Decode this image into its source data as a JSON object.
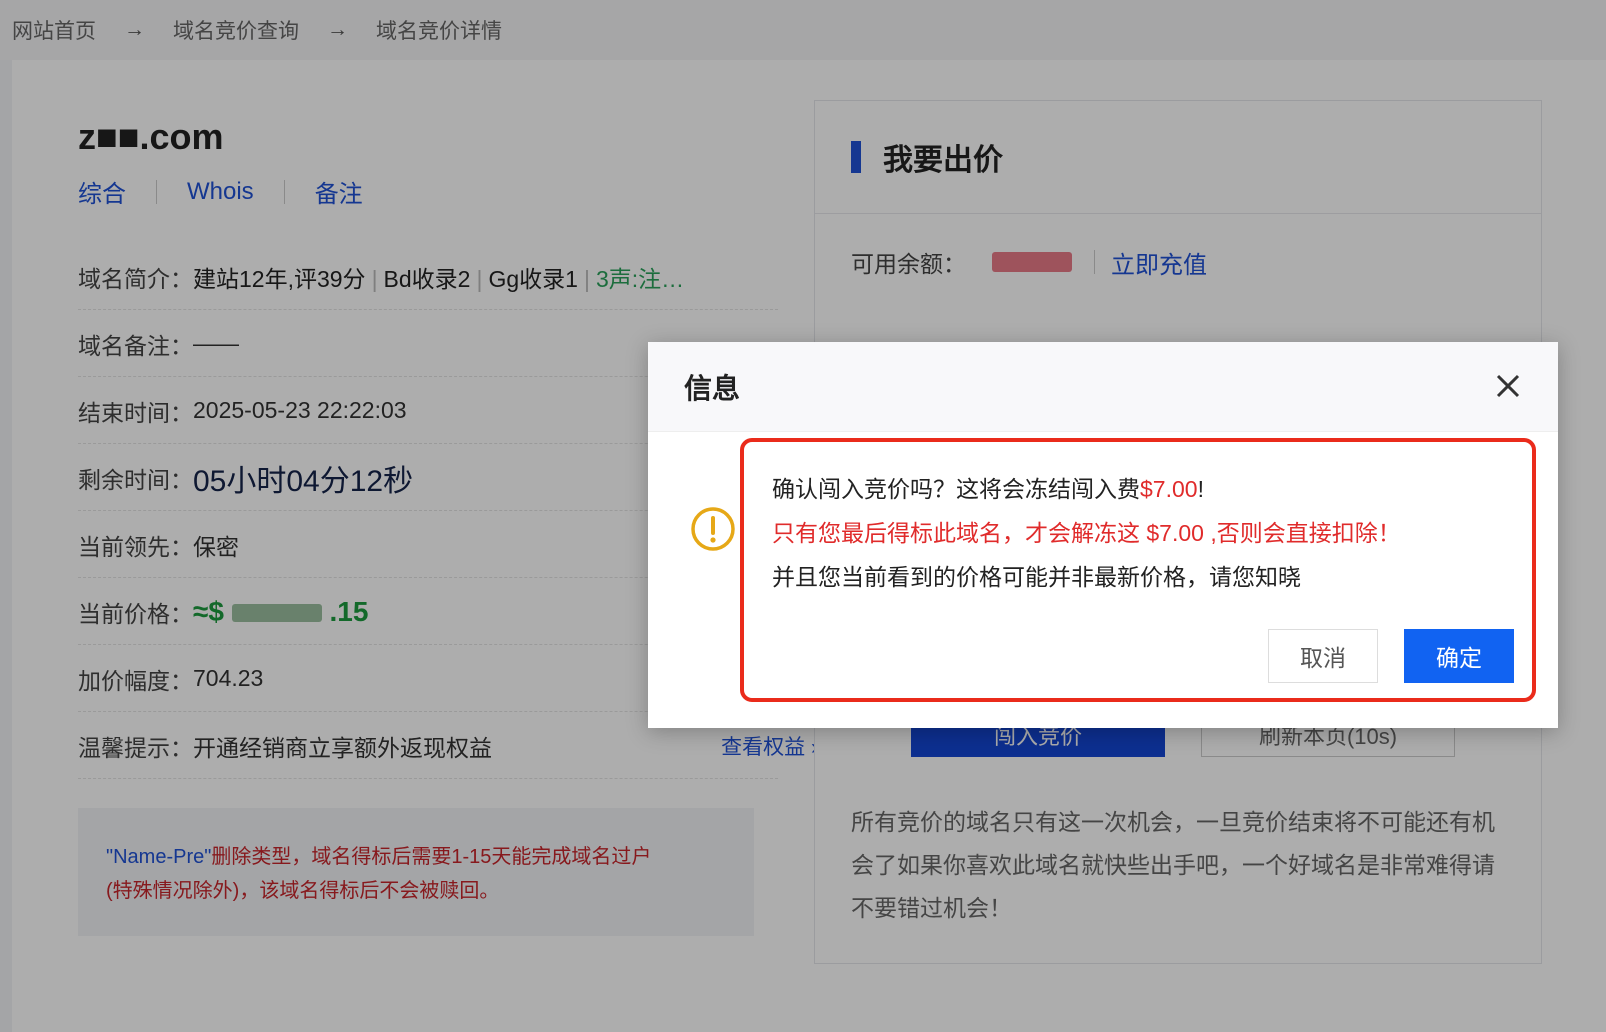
{
  "breadcrumb": {
    "items": [
      "网站首页",
      "域名竞价查询",
      "域名竞价详情"
    ],
    "arrow": "→"
  },
  "domain": {
    "name": "z■■.com",
    "tabs": [
      "综合",
      "Whois",
      "备注"
    ]
  },
  "info": {
    "intro_label": "域名简介：",
    "intro_segments": [
      "建站12年,评39分",
      "Bd收录2",
      "Gg收录1"
    ],
    "intro_green": "3声:注…",
    "note_label": "域名备注：",
    "note_value": "——",
    "end_label": "结束时间：",
    "end_value": "2025-05-23 22:22:03",
    "remain_label": "剩余时间：",
    "remain_value": "05小时04分12秒",
    "leader_label": "当前领先：",
    "leader_value": "保密",
    "price_label": "当前价格：",
    "price_prefix": "≈$",
    "price_suffix": ".15",
    "increment_label": "加价幅度：",
    "increment_value": "704.23",
    "tip_label": "温馨提示：",
    "tip_value": "开通经销商立享额外返现权益",
    "tip_link": "查看权益 ›"
  },
  "notice": {
    "blue": "\"Name-Pre\"",
    "line1": "删除类型，域名得标后需要1-15天能完成域名过户",
    "line2": "(特殊情况除外)，该域名得标后不会被赎回。"
  },
  "bid": {
    "title": "我要出价",
    "balance_label": "可用余额：",
    "recharge": "立即充值",
    "enter_button": "闯入竞价",
    "refresh_button": "刷新本页(10s)",
    "desc": "所有竞价的域名只有这一次机会，一旦竞价结束将不可能还有机会了如果你喜欢此域名就快些出手吧，一个好域名是非常难得请不要错过机会！"
  },
  "modal": {
    "title": "信息",
    "msg1_prefix": "确认闯入竞价吗？这将会冻结闯入费",
    "msg1_amount": "$7.00",
    "msg1_suffix": "!",
    "msg2": "只有您最后得标此域名，才会解冻这 $7.00 ,否则会直接扣除！",
    "msg3": "并且您当前看到的价格可能并非最新价格，请您知晓",
    "cancel": "取消",
    "confirm": "确定"
  },
  "colors": {
    "link_blue": "#2052d6",
    "confirm_blue": "#1163f2",
    "warning_red": "#e02b2b",
    "highlight_border": "#ea2b1b",
    "warning_icon": "#e6a817"
  }
}
